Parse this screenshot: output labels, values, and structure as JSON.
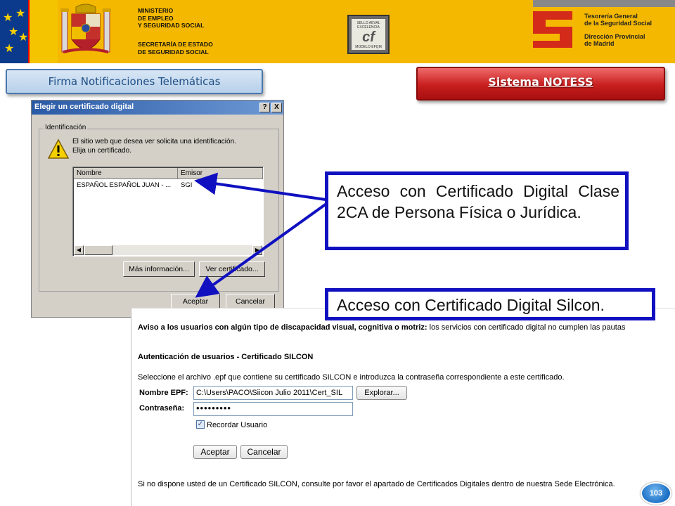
{
  "header": {
    "ministry_lines": [
      "MINISTERIO",
      "DE  EMPLEO",
      "Y SEGURIDAD SOCIAL"
    ],
    "secretaria_lines": [
      "SECRETARÍA DE ESTADO",
      "DE SEGURIDAD SOCIAL"
    ],
    "sello_lines": [
      "SELLO AEVAL",
      "EXCELENCIA",
      "MODELO EFQM"
    ],
    "tgss_lines": [
      "Tesorería General",
      "de la Seguridad Social"
    ],
    "dp_lines": [
      "Dirección Provincial",
      "de Madrid"
    ]
  },
  "buttons": {
    "firma": "Firma Notificaciones Telemáticas",
    "notess": "Sistema NOTESS"
  },
  "dialog": {
    "title": "Elegir un certificado digital",
    "help_btn": "?",
    "close_btn": "X",
    "group_label": "Identificación",
    "message_line1": "El sitio web que desea ver solicita una identificación.",
    "message_line2": "Elija un certificado.",
    "columns": [
      "Nombre",
      "Emisor"
    ],
    "rows": [
      {
        "nombre": "ESPAÑOL ESPAÑOL JUAN - ...",
        "emisor": "SGI"
      }
    ],
    "more_info": "Más información...",
    "view_cert": "Ver certificado...",
    "accept": "Aceptar",
    "cancel": "Cancelar"
  },
  "callouts": {
    "first": "Acceso con Certificado Digital Clase 2CA de Persona Física o Jurídica.",
    "second": "Acceso con Certificado Digital Silcon."
  },
  "silcon": {
    "aviso_bold": "Aviso a los usuarios con algún tipo de discapacidad visual, cognitiva o motriz:",
    "aviso_rest": " los servicios con certificado digital no cumplen las pautas",
    "auth_title": "Autenticación de usuarios - Certificado SILCON",
    "instructions": "Seleccione el archivo .epf que contiene su certificado SILCON e introduzca la contraseña correspondiente a este certificado.",
    "epf_label": "Nombre EPF:",
    "epf_value": "C:\\Users\\PACO\\Siicon Julio 2011\\Cert_SIL",
    "explore": "Explorar...",
    "password_label": "Contraseña:",
    "password_value": "•••••••••",
    "remember_checked": true,
    "remember_label": "Recordar Usuario",
    "accept": "Aceptar",
    "cancel": "Cancelar",
    "footer": "Si no dispone usted de un Certificado SILCON, consulte por favor el apartado de Certificados Digitales dentro de nuestra Sede Electrónica."
  },
  "page_number": "103",
  "colors": {
    "header_yellow": "#f5b800",
    "callout_border": "#1010c0",
    "notess_red": "#c81e1e",
    "firma_blue": "#1f4f84"
  }
}
